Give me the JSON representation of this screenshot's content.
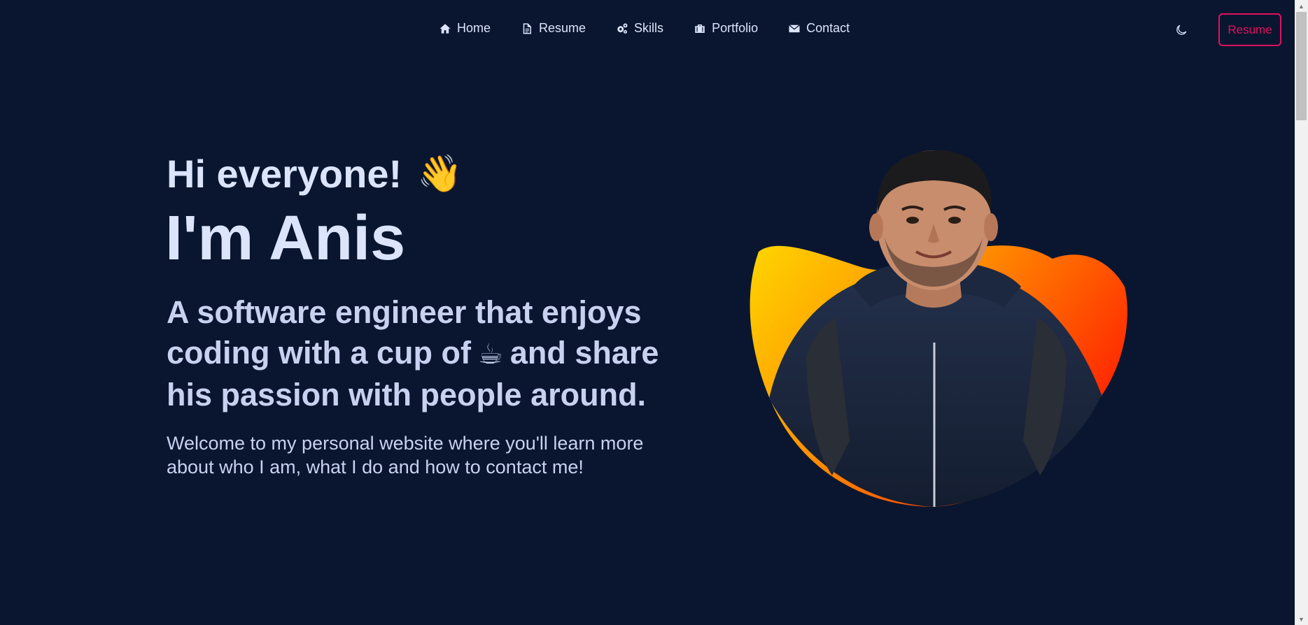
{
  "nav": {
    "items": [
      {
        "label": "Home",
        "icon": "home-icon"
      },
      {
        "label": "Resume",
        "icon": "document-icon"
      },
      {
        "label": "Skills",
        "icon": "gears-icon"
      },
      {
        "label": "Portfolio",
        "icon": "briefcase-icon"
      },
      {
        "label": "Contact",
        "icon": "envelope-icon"
      }
    ],
    "theme_toggle_icon": "moon-icon",
    "resume_button": "Resume"
  },
  "hero": {
    "greeting": "Hi everyone!",
    "greeting_emoji": "👋",
    "name": "I'm Anis",
    "tagline_part1": "A software engineer that enjoys coding with a cup of",
    "tagline_emoji": "☕",
    "tagline_part2": "and share his passion with people around.",
    "welcome": "Welcome to my personal website where you'll learn more about who I am, what I do and how to contact me!",
    "portrait_alt": "portrait"
  },
  "colors": {
    "background": "#0a1630",
    "text": "#dbe4fb",
    "accent": "#e0115f",
    "blob_start": "#ffd500",
    "blob_end": "#ff2a00"
  }
}
